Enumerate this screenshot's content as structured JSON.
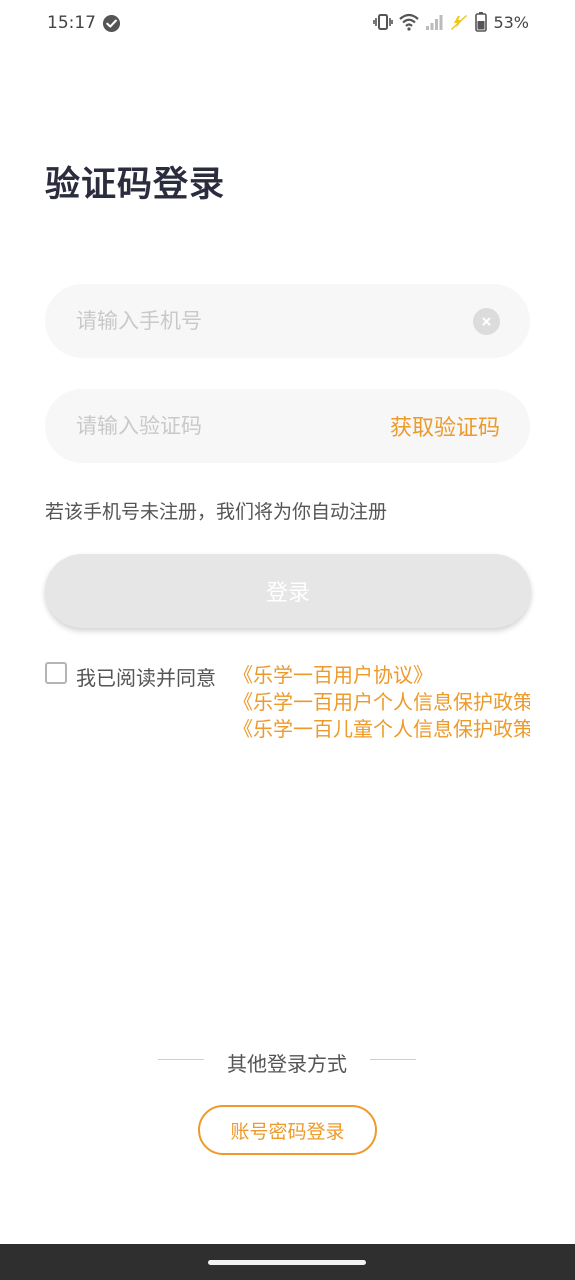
{
  "status_bar": {
    "time": "15:17",
    "battery": "53%"
  },
  "title": "验证码登录",
  "phone_field": {
    "placeholder": "请输入手机号",
    "value": ""
  },
  "code_field": {
    "placeholder": "请输入验证码",
    "value": "",
    "get_code_label": "获取验证码"
  },
  "register_hint": "若该手机号未注册，我们将为你自动注册",
  "login_button": "登录",
  "agreement": {
    "checked": false,
    "prefix": "我已阅读并同意",
    "links": [
      "《乐学一百用户协议》",
      "《乐学一百用户个人信息保护政策》",
      "《乐学一百儿童个人信息保护政策》"
    ]
  },
  "other_login": {
    "label": "其他登录方式",
    "password_login_button": "账号密码登录"
  },
  "colors": {
    "accent": "#ee9a2a",
    "title": "#2b2c3d",
    "field_bg": "#f7f7f7",
    "disabled_button": "#e6e6e6"
  }
}
